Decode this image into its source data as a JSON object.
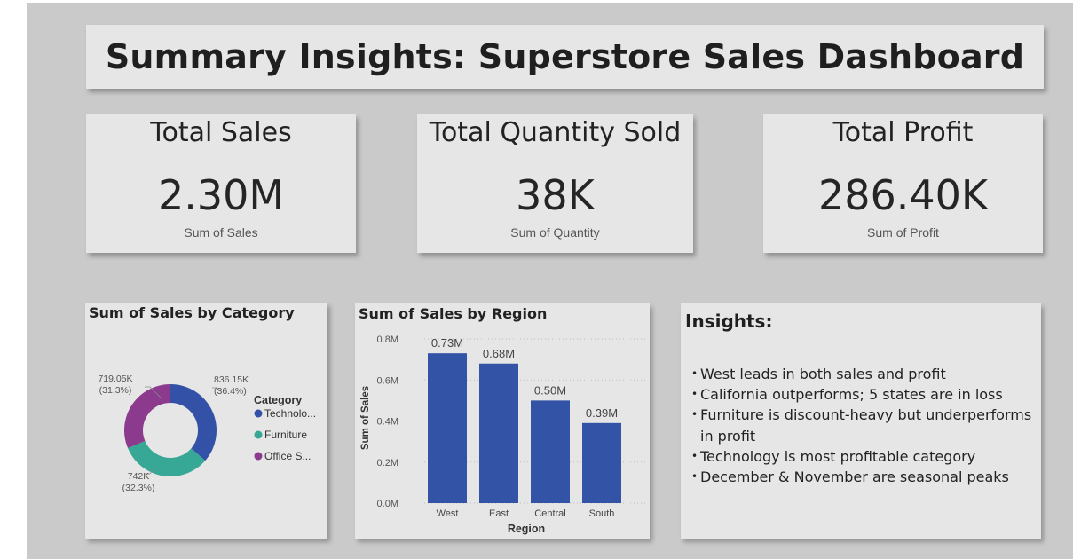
{
  "header": {
    "title": "Summary Insights: Superstore Sales Dashboard"
  },
  "kpis": [
    {
      "title": "Total Sales",
      "value": "2.30M",
      "label": "Sum of Sales"
    },
    {
      "title": "Total Quantity Sold",
      "value": "38K",
      "label": "Sum of Quantity"
    },
    {
      "title": "Total Profit",
      "value": "286.40K",
      "label": "Sum of Profit"
    }
  ],
  "donut": {
    "title": "Sum of Sales by Category",
    "legend_title": "Category"
  },
  "bar": {
    "title": "Sum of Sales by Region"
  },
  "insights": {
    "title": "Insights:",
    "items": [
      "West leads in both sales and profit",
      "California outperforms; 5 states are in loss",
      "Furniture is discount-heavy but underperforms in profit",
      "Technology is most profitable category",
      "December & November are seasonal peaks"
    ]
  },
  "colors": {
    "canvas": "#cacaca",
    "card": "#e6e6e6",
    "technology": "#3351a6",
    "furniture": "#36a895",
    "office_supplies": "#8b3a8d",
    "bar": "#3353a6"
  },
  "chart_data": [
    {
      "type": "pie",
      "title": "Sum of Sales by Category",
      "legend_title": "Category",
      "legend_position": "right",
      "categories": [
        "Technolo...",
        "Furniture",
        "Office S..."
      ],
      "values": [
        836150,
        742000,
        719050
      ],
      "value_labels": [
        "836.15K",
        "742K",
        "719.05K"
      ],
      "percent_labels": [
        "(36.4%)",
        "(32.3%)",
        "(31.3%)"
      ]
    },
    {
      "type": "bar",
      "title": "Sum of Sales by Region",
      "xlabel": "Region",
      "ylabel": "Sum of Sales",
      "categories": [
        "West",
        "East",
        "Central",
        "South"
      ],
      "values": [
        0.73,
        0.68,
        0.5,
        0.39
      ],
      "value_labels": [
        "0.73M",
        "0.68M",
        "0.50M",
        "0.39M"
      ],
      "yticks": [
        "0.0M",
        "0.2M",
        "0.4M",
        "0.6M",
        "0.8M"
      ],
      "ylim": [
        0,
        0.8
      ],
      "grid": true
    }
  ]
}
